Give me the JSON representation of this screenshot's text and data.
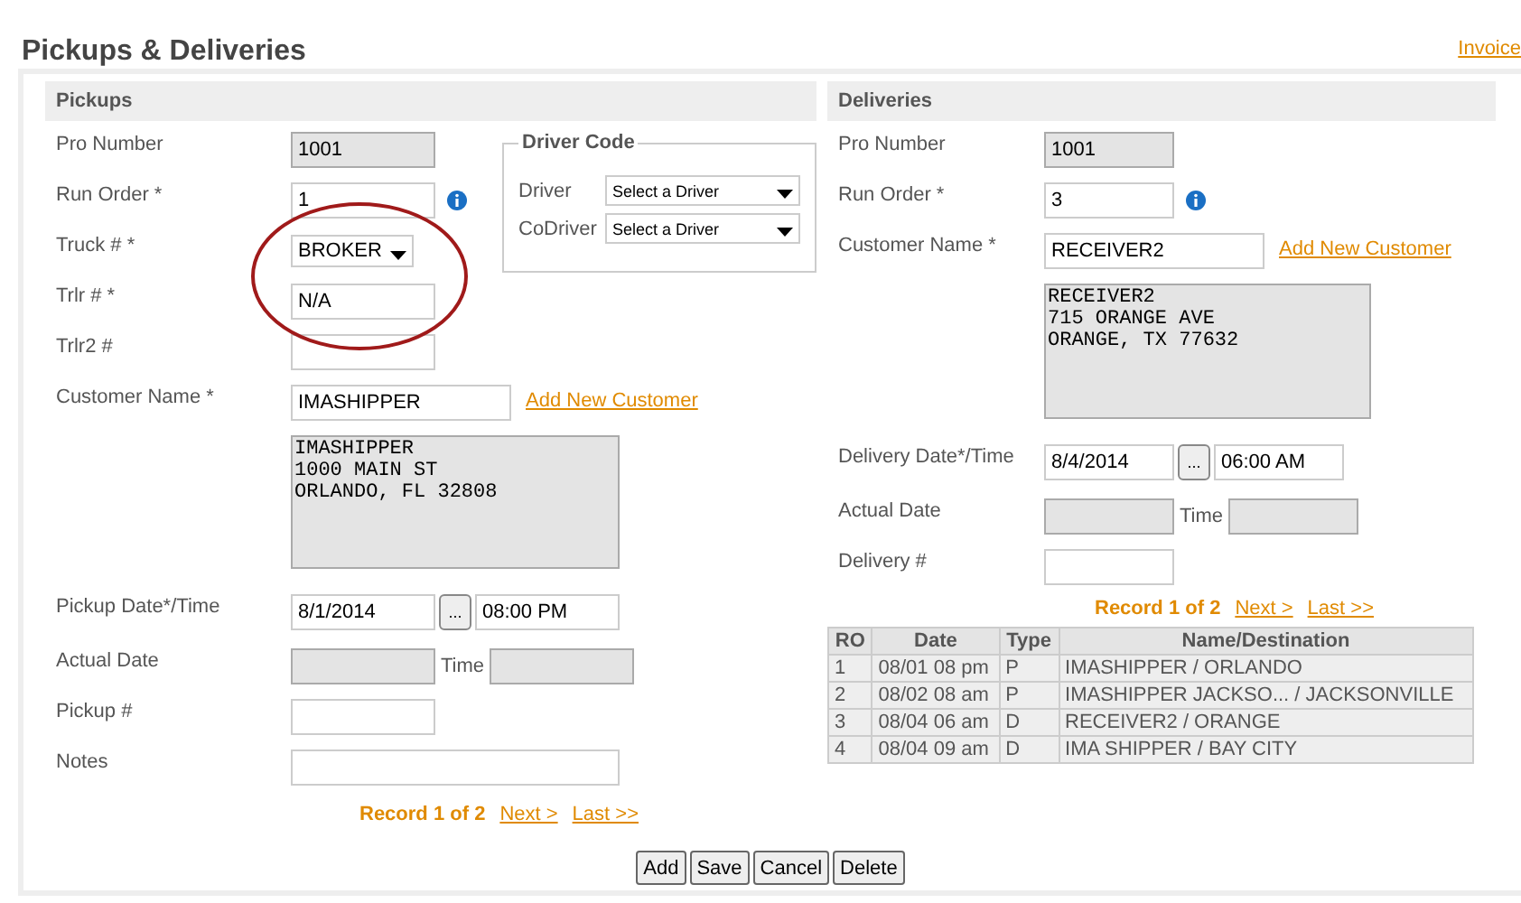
{
  "page": {
    "title": "Pickups & Deliveries",
    "invoice_link": "Invoice"
  },
  "pickups": {
    "heading": "Pickups",
    "rows": [
      {
        "kind": "readonly",
        "label": "Pro Number",
        "value": "1001"
      },
      {
        "kind": "text",
        "label": "Run Order *",
        "value": "1",
        "help": true
      },
      {
        "kind": "select",
        "label": "Truck # *",
        "value": "BROKER"
      },
      {
        "kind": "text",
        "label": "Trlr # *",
        "value": "N/A"
      },
      {
        "kind": "text",
        "label": "Trlr2 #"
      },
      {
        "kind": "customer",
        "label": "Customer Name *",
        "value": "IMASHIPPER",
        "link": "Add New Customer"
      },
      {
        "kind": "address",
        "lines": [
          "IMASHIPPER",
          "1000 MAIN ST",
          "ORLANDO, FL 32808"
        ]
      },
      {
        "kind": "datetime",
        "label": "Pickup Date*/Time",
        "date": "8/1/2014",
        "button": "...",
        "time": "08:00 PM"
      },
      {
        "kind": "actual",
        "label": "Actual Date",
        "time_label": "Time"
      },
      {
        "kind": "text",
        "label": "Pickup #"
      },
      {
        "kind": "wide",
        "label": "Notes"
      }
    ],
    "pager": {
      "record": "Record 1 of 2",
      "next": "Next >",
      "last": "Last >>"
    }
  },
  "driver_code": {
    "title": "Driver Code",
    "rows": [
      {
        "label": "Driver",
        "value": "Select a Driver"
      },
      {
        "label": "CoDriver",
        "value": "Select a Driver"
      }
    ]
  },
  "deliveries": {
    "heading": "Deliveries",
    "rows": [
      {
        "kind": "readonly",
        "label": "Pro Number",
        "value": "1001"
      },
      {
        "kind": "text",
        "label": "Run Order *",
        "value": "3",
        "help": true
      },
      {
        "kind": "customer",
        "label": "Customer Name *",
        "value": "RECEIVER2",
        "link": "Add New Customer"
      },
      {
        "kind": "address",
        "lines": [
          "RECEIVER2",
          "715 ORANGE AVE",
          "ORANGE, TX 77632"
        ]
      },
      {
        "kind": "datetime",
        "label": "Delivery Date*/Time",
        "date": "8/4/2014",
        "button": "...",
        "time": "06:00 AM"
      },
      {
        "kind": "actual",
        "label": "Actual Date",
        "time_label": "Time"
      },
      {
        "kind": "text",
        "label": "Delivery #"
      }
    ],
    "pager": {
      "record": "Record 1 of 2",
      "next": "Next >",
      "last": "Last >>"
    }
  },
  "table": {
    "columns": [
      "RO",
      "Date",
      "Type",
      "Name/Destination"
    ],
    "rows": [
      [
        "1",
        "08/01 08 pm",
        "P",
        "IMASHIPPER / ORLANDO"
      ],
      [
        "2",
        "08/02 08 am",
        "P",
        "IMASHIPPER JACKSO... / JACKSONVILLE"
      ],
      [
        "3",
        "08/04 06 am",
        "D",
        "RECEIVER2 / ORANGE"
      ],
      [
        "4",
        "08/04 09 am",
        "D",
        "IMA SHIPPER / BAY CITY"
      ]
    ]
  },
  "buttons": [
    "Add",
    "Save",
    "Cancel",
    "Delete"
  ]
}
